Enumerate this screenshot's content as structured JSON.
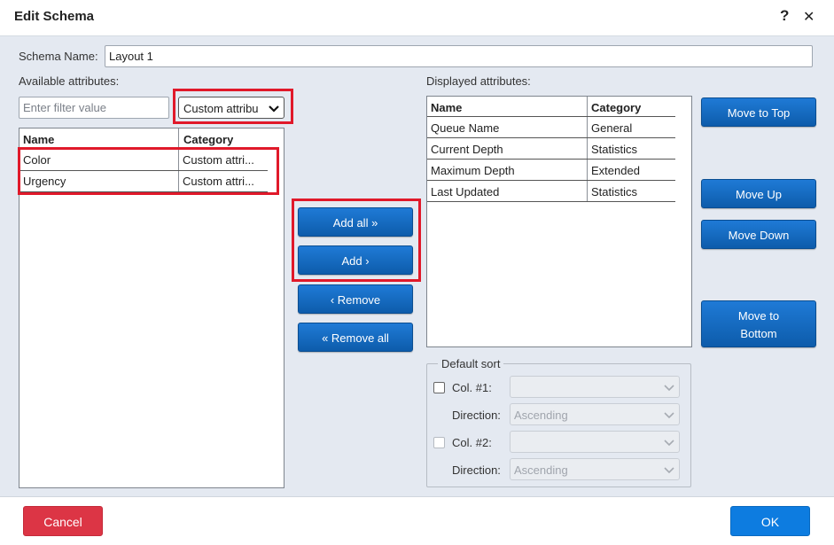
{
  "dialog": {
    "title": "Edit Schema",
    "help_glyph": "?",
    "close_glyph": "✕"
  },
  "schema_name": {
    "label": "Schema Name:",
    "value": "Layout 1"
  },
  "available": {
    "label": "Available attributes:",
    "filter_placeholder": "Enter filter value",
    "category_select": "Custom attribu",
    "columns": [
      "Name",
      "Category"
    ],
    "rows": [
      {
        "name": "Color",
        "category": "Custom attri..."
      },
      {
        "name": "Urgency",
        "category": "Custom attri..."
      }
    ]
  },
  "transfer_buttons": {
    "add_all": "Add all »",
    "add": "Add ›",
    "remove": "‹ Remove",
    "remove_all": "« Remove all"
  },
  "displayed": {
    "label": "Displayed attributes:",
    "columns": [
      "Name",
      "Category"
    ],
    "rows": [
      {
        "name": "Queue Name",
        "category": "General"
      },
      {
        "name": "Current Depth",
        "category": "Statistics"
      },
      {
        "name": "Maximum Depth",
        "category": "Extended"
      },
      {
        "name": "Last Updated",
        "category": "Statistics"
      }
    ]
  },
  "order_buttons": {
    "move_to_top": "Move to Top",
    "move_up": "Move Up",
    "move_down": "Move Down",
    "move_to_bottom_line1": "Move to",
    "move_to_bottom_line2": "Bottom"
  },
  "default_sort": {
    "legend": "Default sort",
    "col1_label": "Col. #1:",
    "col1_value": "",
    "direction1_label": "Direction:",
    "direction1_value": "Ascending",
    "col2_label": "Col. #2:",
    "col2_value": "",
    "direction2_label": "Direction:",
    "direction2_value": "Ascending"
  },
  "footer": {
    "cancel": "Cancel",
    "ok": "OK"
  },
  "colors": {
    "primary_button": "#0d5cab",
    "highlight_box": "#e0192a",
    "cancel_button": "#dc3545",
    "ok_button": "#0d7ce0",
    "background": "#e4e9f1"
  }
}
